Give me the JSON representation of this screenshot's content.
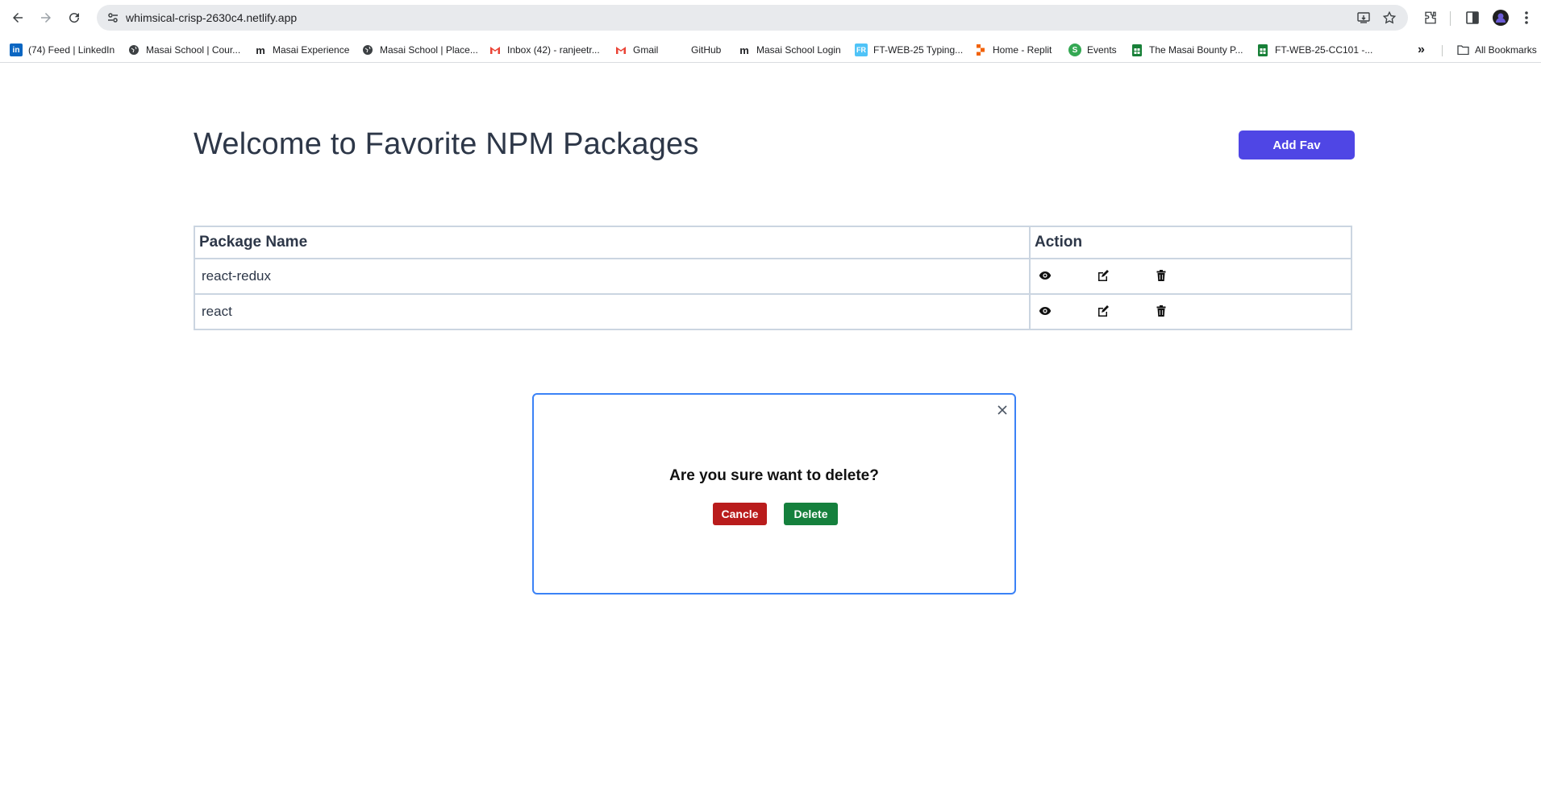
{
  "browser": {
    "url": "whimsical-crisp-2630c4.netlify.app",
    "bookmarks": [
      {
        "label": "(74) Feed | LinkedIn",
        "icon": "linkedin-icon"
      },
      {
        "label": "Masai School | Cour...",
        "icon": "globe-icon"
      },
      {
        "label": "Masai Experience",
        "icon": "masai-icon"
      },
      {
        "label": "Masai School | Place...",
        "icon": "globe-icon"
      },
      {
        "label": "Inbox (42) - ranjeetr...",
        "icon": "gmail-icon"
      },
      {
        "label": "Gmail",
        "icon": "gmail-icon"
      },
      {
        "label": "GitHub",
        "icon": "github-icon"
      },
      {
        "label": "Masai School Login",
        "icon": "masai-icon"
      },
      {
        "label": "FT-WEB-25 Typing...",
        "icon": "typing-icon"
      },
      {
        "label": "Home - Replit",
        "icon": "replit-icon"
      },
      {
        "label": "Events",
        "icon": "events-icon"
      },
      {
        "label": "The Masai Bounty P...",
        "icon": "sheets-icon"
      },
      {
        "label": "FT-WEB-25-CC101 -...",
        "icon": "sheets-icon"
      }
    ],
    "all_bookmarks_label": "All Bookmarks",
    "more_label": "»"
  },
  "page": {
    "title": "Welcome to Favorite NPM Packages",
    "add_fav_label": "Add Fav"
  },
  "table": {
    "headers": [
      "Package Name",
      "Action"
    ],
    "rows": [
      {
        "name": "react-redux"
      },
      {
        "name": "react"
      }
    ]
  },
  "modal": {
    "message": "Are you sure want to delete?",
    "cancel_label": "Cancle",
    "delete_label": "Delete",
    "border_color": "#3b82f6"
  },
  "colors": {
    "accent": "#4f46e5",
    "cancel": "#b91c1c",
    "delete": "#15803d"
  }
}
